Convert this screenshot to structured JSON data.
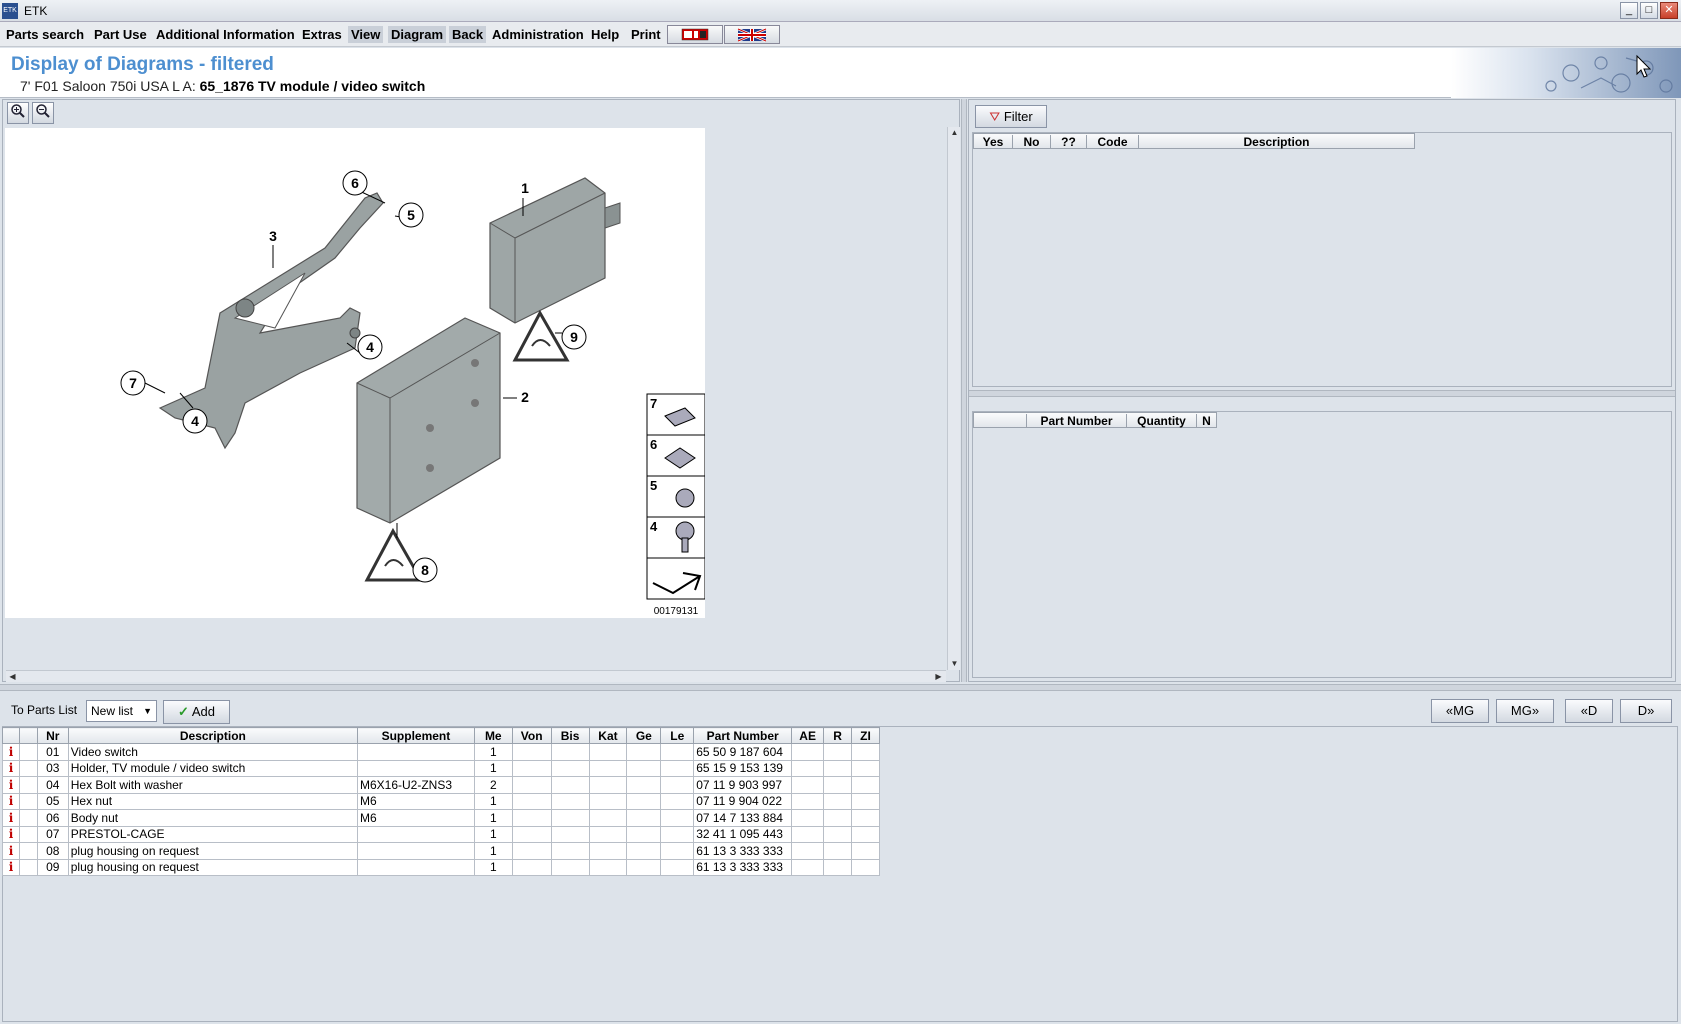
{
  "window": {
    "title": "ETK",
    "app_icon": "etk-app-icon",
    "controls": {
      "minimize": "_",
      "maximize": "□",
      "close": "✕"
    }
  },
  "menu": {
    "items": [
      "Parts search",
      "Part Use",
      "Additional Information",
      "Extras",
      "View",
      "Diagram",
      "Back",
      "Administration",
      "Help",
      "Print"
    ]
  },
  "header": {
    "title": "Display of Diagrams - filtered",
    "vehicle": "7' F01 Saloon 750i USA  L A:",
    "group": "65_1876 TV module / video switch"
  },
  "diagram": {
    "image_number": "00179131",
    "callouts": [
      "1",
      "2",
      "3",
      "4",
      "4",
      "5",
      "6",
      "7",
      "8",
      "9"
    ],
    "legend": [
      "7",
      "6",
      "5",
      "4"
    ]
  },
  "filter": {
    "button_label": "Filter",
    "columns": [
      "Yes",
      "No",
      "??",
      "Code",
      "Description"
    ]
  },
  "selection": {
    "columns": [
      "",
      "",
      "Part Number",
      "Quantity",
      "N"
    ]
  },
  "toolbar": {
    "to_parts_list": "To Parts List",
    "list_select": "New list",
    "add_label": "Add",
    "nav": [
      "«MG",
      "MG»",
      "«D",
      "D»"
    ]
  },
  "parts": {
    "columns": [
      "",
      "",
      "Nr",
      "Description",
      "Supplement",
      "Me",
      "Von",
      "Bis",
      "Kat",
      "Ge",
      "Le",
      "Part Number",
      "AE",
      "R",
      "ZI"
    ],
    "rows": [
      {
        "nr": "01",
        "desc": "Video switch",
        "supp": "",
        "me": "1",
        "pn": "65 50 9 187 604"
      },
      {
        "nr": "03",
        "desc": "Holder, TV module / video switch",
        "supp": "",
        "me": "1",
        "pn": "65 15 9 153 139"
      },
      {
        "nr": "04",
        "desc": "Hex Bolt with washer",
        "supp": "M6X16-U2-ZNS3",
        "me": "2",
        "pn": "07 11 9 903 997"
      },
      {
        "nr": "05",
        "desc": "Hex nut",
        "supp": "M6",
        "me": "1",
        "pn": "07 11 9 904 022"
      },
      {
        "nr": "06",
        "desc": "Body nut",
        "supp": "M6",
        "me": "1",
        "pn": "07 14 7 133 884"
      },
      {
        "nr": "07",
        "desc": "PRESTOL-CAGE",
        "supp": "",
        "me": "1",
        "pn": "32 41 1 095 443"
      },
      {
        "nr": "08",
        "desc": "plug housing on request",
        "supp": "",
        "me": "1",
        "pn": "61 13 3 333 333"
      },
      {
        "nr": "09",
        "desc": "plug housing on request",
        "supp": "",
        "me": "1",
        "pn": "61 13 3 333 333"
      }
    ]
  }
}
